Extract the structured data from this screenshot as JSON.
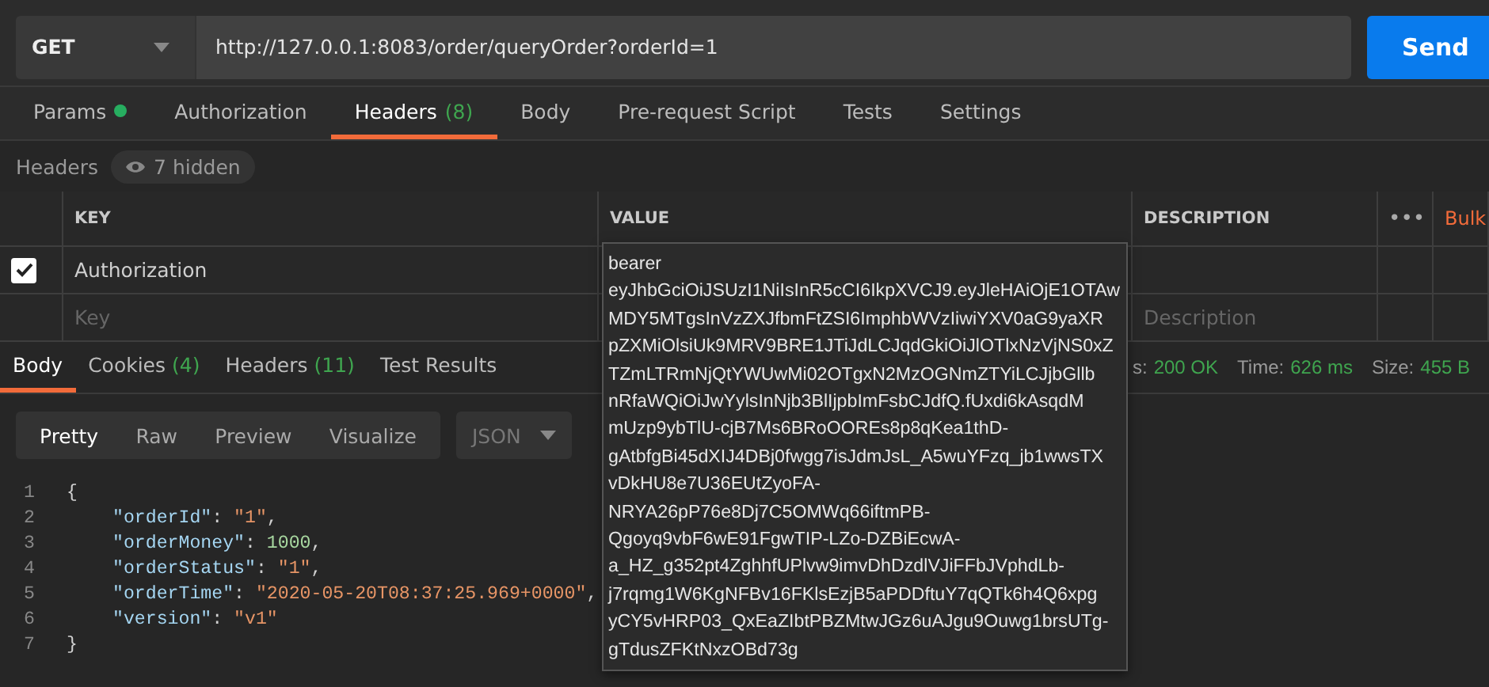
{
  "request": {
    "method": "GET",
    "url": "http://127.0.0.1:8083/order/queryOrder?orderId=1",
    "send": "Send"
  },
  "tabs": [
    {
      "label": "Params",
      "dot": true,
      "selected": false
    },
    {
      "label": "Authorization",
      "dot": false,
      "selected": false
    },
    {
      "label": "Headers",
      "count": "(8)",
      "dot": false,
      "selected": true
    },
    {
      "label": "Body",
      "dot": false,
      "selected": false
    },
    {
      "label": "Pre-request Script",
      "dot": false,
      "selected": false
    },
    {
      "label": "Tests",
      "dot": false,
      "selected": false
    },
    {
      "label": "Settings",
      "dot": false,
      "selected": false
    }
  ],
  "headers_bar": {
    "label": "Headers",
    "hidden": "7 hidden"
  },
  "table": {
    "columns": [
      "KEY",
      "VALUE",
      "DESCRIPTION"
    ],
    "more": "•••",
    "bulk": "Bulk",
    "rows": [
      {
        "key": "Authorization",
        "checked": true
      }
    ],
    "new_row": {
      "key_placeholder": "Key",
      "description_placeholder": "Description"
    }
  },
  "response_tabs": [
    {
      "label": "Body",
      "selected": true
    },
    {
      "label": "Cookies",
      "count": "(4)",
      "selected": false
    },
    {
      "label": "Headers",
      "count": "(11)",
      "selected": false
    },
    {
      "label": "Test Results",
      "selected": false
    }
  ],
  "status": [
    {
      "label": "s:",
      "value": "200 OK"
    },
    {
      "label": "Time:",
      "value": "626 ms"
    },
    {
      "label": "Size:",
      "value": "455 B"
    }
  ],
  "view_modes": [
    {
      "label": "Pretty",
      "selected": true
    },
    {
      "label": "Raw",
      "selected": false
    },
    {
      "label": "Preview",
      "selected": false
    },
    {
      "label": "Visualize",
      "selected": false
    }
  ],
  "format": "JSON",
  "code": [
    {
      "number": "1",
      "tokens": [
        {
          "kind": "punct",
          "text": "{"
        }
      ]
    },
    {
      "number": "2",
      "tokens": [
        {
          "kind": "key",
          "text": "\"orderId\""
        },
        {
          "kind": "punct",
          "text": ": "
        },
        {
          "kind": "string",
          "text": "\"1\""
        },
        {
          "kind": "punct",
          "text": ","
        }
      ]
    },
    {
      "number": "3",
      "tokens": [
        {
          "kind": "key",
          "text": "\"orderMoney\""
        },
        {
          "kind": "punct",
          "text": ": "
        },
        {
          "kind": "number",
          "text": "1000"
        },
        {
          "kind": "punct",
          "text": ","
        }
      ]
    },
    {
      "number": "4",
      "tokens": [
        {
          "kind": "key",
          "text": "\"orderStatus\""
        },
        {
          "kind": "punct",
          "text": ": "
        },
        {
          "kind": "string",
          "text": "\"1\""
        },
        {
          "kind": "punct",
          "text": ","
        }
      ]
    },
    {
      "number": "5",
      "tokens": [
        {
          "kind": "key",
          "text": "\"orderTime\""
        },
        {
          "kind": "punct",
          "text": ": "
        },
        {
          "kind": "string",
          "text": "\"2020-05-20T08:37:25.969+0000\""
        },
        {
          "kind": "punct",
          "text": ","
        }
      ]
    },
    {
      "number": "6",
      "tokens": [
        {
          "kind": "key",
          "text": "\"version\""
        },
        {
          "kind": "punct",
          "text": ": "
        },
        {
          "kind": "string",
          "text": "\"v1\""
        }
      ]
    },
    {
      "number": "7",
      "tokens": [
        {
          "kind": "punct",
          "text": "}"
        }
      ]
    }
  ],
  "tooltip": {
    "lines": [
      "bearer",
      "eyJhbGciOiJSUzI1NiIsInR5cCI6IkpXVCJ9.eyJleHAiOjE1OTAw",
      "MDY5MTgsInVzZXJfbmFtZSI6ImphbWVzIiwiYXV0aG9yaXR",
      "pZXMiOlsiUk9MRV9BRE1JTiJdLCJqdGkiOiJlOTlxNzVjNS0xZ",
      "TZmLTRmNjQtYWUwMi02OTgxN2MzOGNmZTYiLCJjbGllb",
      "nRfaWQiOiJwYylsInNjb3BlIjpbImFsbCJdfQ.fUxdi6kAsqdM",
      "mUzp9ybTlU-cjB7Ms6BRoOOREs8p8qKea1thD-",
      "gAtbfgBi45dXIJ4DBj0fwgg7isJdmJsL_A5wuYFzq_jb1wwsTX",
      "vDkHU8e7U36EUtZyoFA-",
      "NRYA26pP76e8Dj7C5OMWq66iftmPB-",
      "Qgoyq9vbF6wE91FgwTIP-LZo-DZBiEcwA-",
      "a_HZ_g352pt4ZghhfUPlvw9imvDhDzdlVJiFFbJVphdLb-",
      "j7rqmg1W6KgNFBv16FKlsEzjB5aPDDftuY7qQTk6h4Q6xpg",
      "yCY5vHRP03_QxEaZIbtPBZMtwJGz6uAJgu9Ouwg1brsUTg-",
      "gTdusZFKtNxzOBd73g"
    ]
  }
}
